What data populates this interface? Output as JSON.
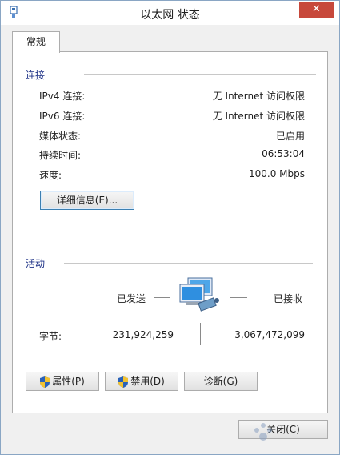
{
  "window": {
    "title": "以太网 状态",
    "close_glyph": "✕"
  },
  "tabs": [
    {
      "label": "常规"
    }
  ],
  "connection": {
    "section_title": "连接",
    "rows": [
      {
        "label": "IPv4 连接:",
        "value": "无 Internet 访问权限"
      },
      {
        "label": "IPv6 连接:",
        "value": "无 Internet 访问权限"
      },
      {
        "label": "媒体状态:",
        "value": "已启用"
      },
      {
        "label": "持续时间:",
        "value": "06:53:04"
      },
      {
        "label": "速度:",
        "value": "100.0 Mbps"
      }
    ],
    "details_button": "详细信息(E)..."
  },
  "activity": {
    "section_title": "活动",
    "sent_label": "已发送",
    "received_label": "已接收",
    "bytes_label": "字节:",
    "bytes_sent": "231,924,259",
    "bytes_received": "3,067,472,099"
  },
  "buttons": {
    "properties": "属性(P)",
    "disable": "禁用(D)",
    "diagnose": "诊断(G)",
    "close": "关闭(C)"
  },
  "icons": {
    "app": "network-adapter-icon",
    "network": "network-computers-icon",
    "shield": "uac-shield-icon"
  },
  "colors": {
    "section_title": "#1e3287",
    "close_button": "#c7483b"
  }
}
